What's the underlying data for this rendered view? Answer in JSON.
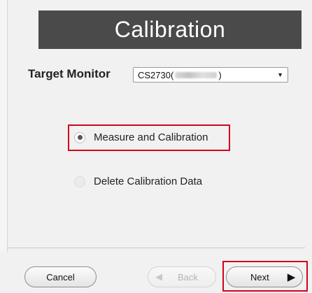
{
  "dialog": {
    "title": "Calibration"
  },
  "target_monitor": {
    "label": "Target Monitor",
    "selected_prefix": "CS2730(",
    "selected_suffix": ")"
  },
  "options": [
    {
      "label": "Measure and Calibration",
      "selected": true
    },
    {
      "label": "Delete Calibration Data",
      "selected": false
    }
  ],
  "buttons": {
    "cancel": "Cancel",
    "back": "Back",
    "next": "Next"
  },
  "icons": {
    "dropdown": "caret-down-icon",
    "back": "triangle-left-icon",
    "next": "triangle-right-icon"
  },
  "colors": {
    "title_bar": "#4a4a4a",
    "highlight": "#d0021b"
  }
}
